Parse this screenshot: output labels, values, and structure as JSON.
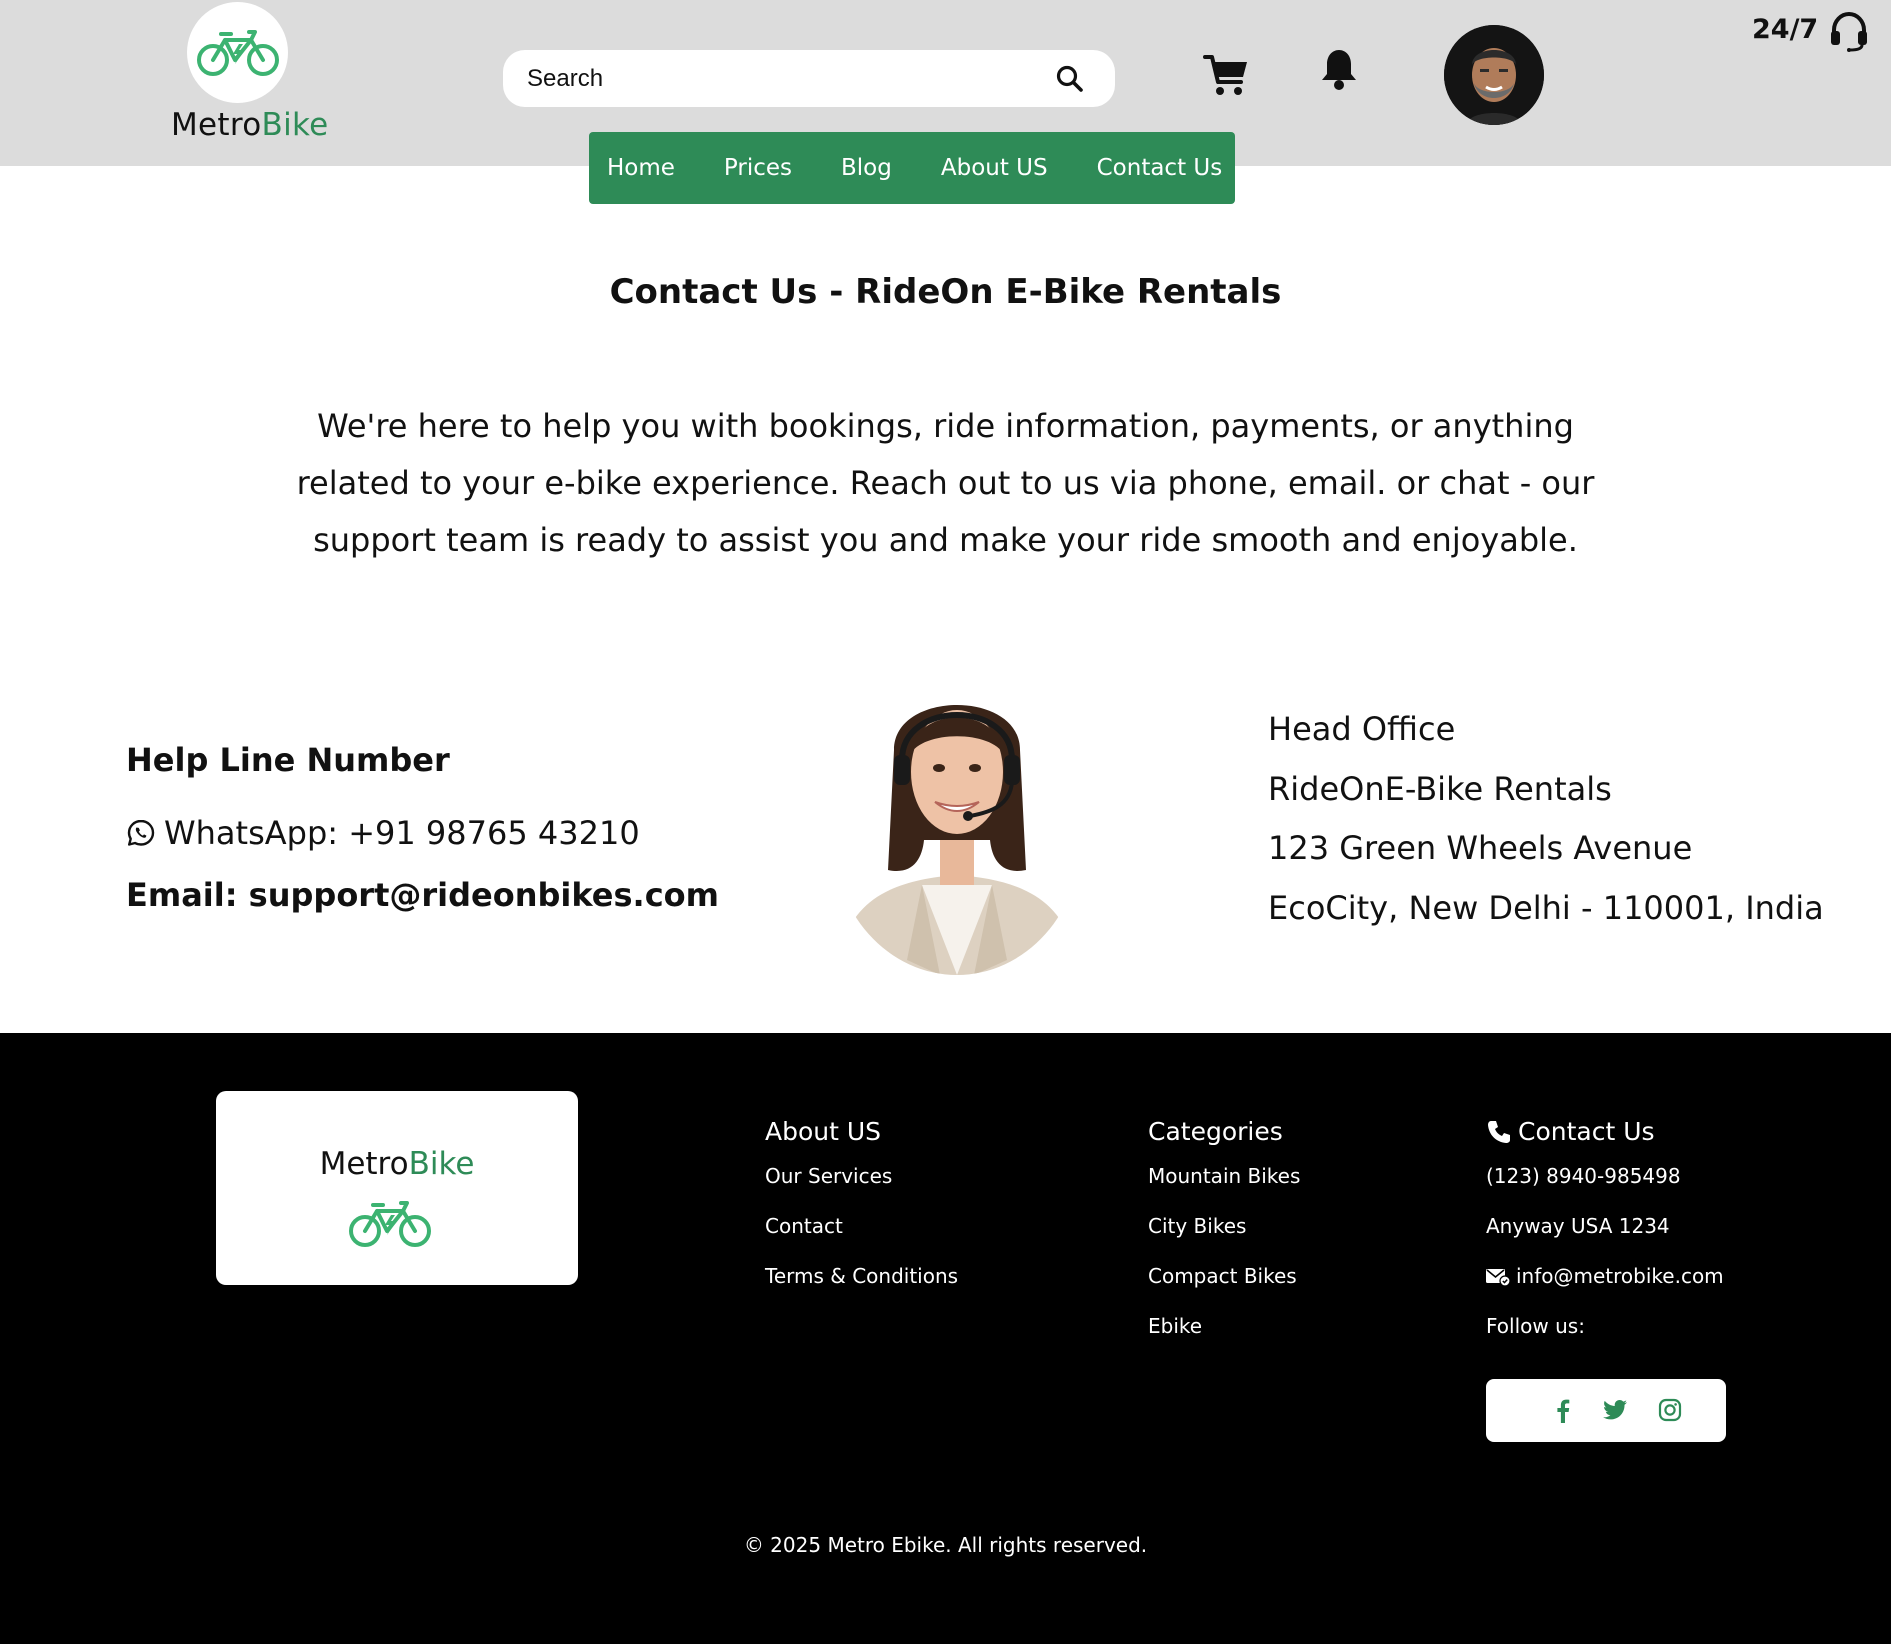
{
  "header": {
    "logo_brand_part1": "Metro",
    "logo_brand_part2": "Bike",
    "search_placeholder": "Search",
    "support_label": "24/7",
    "icons": [
      "bicycle-icon",
      "search-icon",
      "cart-icon",
      "bell-icon",
      "avatar",
      "headset-icon"
    ]
  },
  "nav": {
    "items": [
      {
        "label": "Home"
      },
      {
        "label": "Prices"
      },
      {
        "label": "Blog"
      },
      {
        "label": "About US"
      },
      {
        "label": "Contact Us"
      }
    ]
  },
  "main": {
    "title": "Contact Us - RideOn E-Bike Rentals",
    "intro": "We're here to help you with bookings, ride information, payments, or anything related to your e-bike experience. Reach out to us via phone, email. or chat - our support team is ready to assist you and make your ride smooth and enjoyable.",
    "helpline": {
      "heading": "Help Line Number",
      "whatsapp": "WhatsApp: +91 98765 43210",
      "email": "Email: support@rideonbikes.com"
    },
    "office": {
      "lines": [
        "Head Office",
        "RideOnE-Bike Rentals",
        "123 Green Wheels Avenue",
        "EcoCity, New Delhi - 110001, India"
      ]
    }
  },
  "footer": {
    "logo_brand_part1": "Metro",
    "logo_brand_part2": "Bike",
    "about": {
      "heading": "About US",
      "links": [
        "Our Services",
        "Contact",
        "Terms & Conditions"
      ]
    },
    "categories": {
      "heading": "Categories",
      "links": [
        "Mountain Bikes",
        "City Bikes",
        "Compact Bikes",
        "Ebike"
      ]
    },
    "contact": {
      "heading": "Contact Us",
      "phone": "(123) 8940-985498",
      "address": "Anyway USA 1234",
      "email": "info@metrobike.com",
      "follow": "Follow us:"
    },
    "social": [
      "facebook-icon",
      "twitter-icon",
      "instagram-icon"
    ],
    "copyright": "© 2025 Metro Ebike. All rights reserved."
  },
  "colors": {
    "accent": "#2e8b57",
    "header_bg": "#dcdcdc",
    "footer_bg": "#000000"
  }
}
